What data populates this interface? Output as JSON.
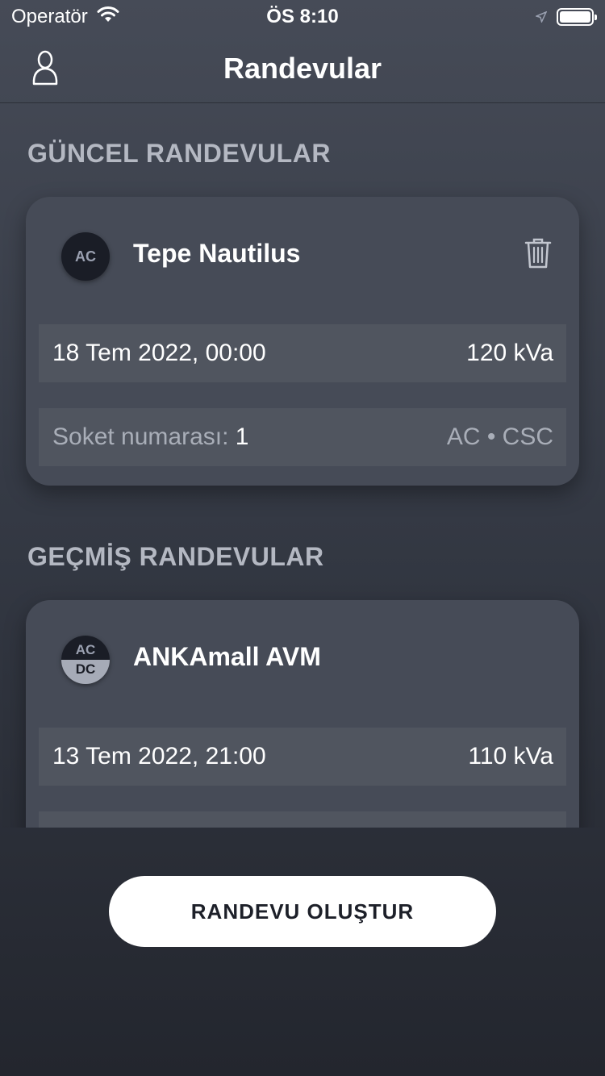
{
  "status_bar": {
    "carrier": "Operatör",
    "time": "ÖS 8:10"
  },
  "nav": {
    "title": "Randevular",
    "profile_icon": "person-icon"
  },
  "sections": {
    "current_title": "GÜNCEL RANDEVULAR",
    "past_title": "GEÇMİŞ RANDEVULAR"
  },
  "current_appointment": {
    "badge": "AC",
    "station": "Tepe Nautilus",
    "date": "18 Tem 2022, 00:00",
    "power": "120 kVa",
    "socket_label": "Soket numarası:",
    "socket_number": "1",
    "connector": "AC • CSC"
  },
  "past_appointment": {
    "badge_top": "AC",
    "badge_bottom": "DC",
    "station": "ANKAmall AVM",
    "date": "13 Tem 2022, 21:00",
    "power": "110 kVa"
  },
  "actions": {
    "create_label": "RANDEVU OLUŞTUR"
  }
}
